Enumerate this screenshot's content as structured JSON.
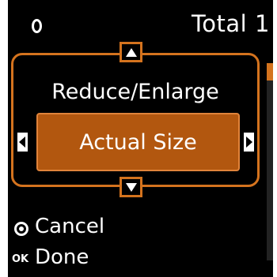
{
  "header": {
    "status_icon": "copy-count-icon",
    "total_label": "Total 1"
  },
  "setting": {
    "title": "Reduce/Enlarge",
    "value": "Actual Size",
    "up_icon": "arrow-up-icon",
    "down_icon": "arrow-down-icon",
    "left_icon": "arrow-left-icon",
    "right_icon": "arrow-right-icon"
  },
  "footer": {
    "cancel_icon": "stop-icon",
    "cancel_label": "Cancel",
    "ok_badge": "OK",
    "done_label": "Done"
  },
  "colors": {
    "accent": "#d4731e",
    "selected_fill": "#b2570f",
    "background": "#000000",
    "text": "#ffffff"
  }
}
